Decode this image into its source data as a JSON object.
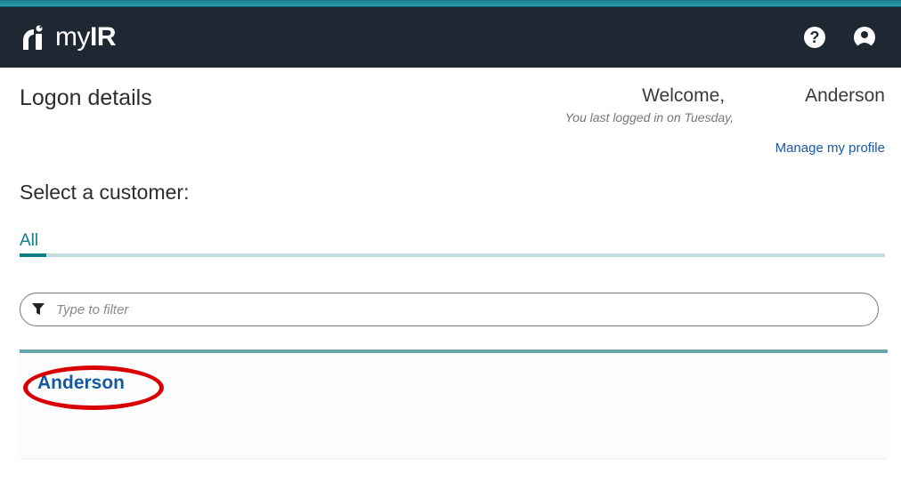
{
  "header": {
    "brand_my": "my",
    "brand_ir": "IR"
  },
  "page": {
    "title": "Logon details",
    "welcome_label": "Welcome,",
    "user_name": "Anderson",
    "last_login": "You last logged in on Tuesday,",
    "manage_profile": "Manage my profile",
    "section_title": "Select a customer:"
  },
  "tabs": {
    "all": "All"
  },
  "filter": {
    "placeholder": "Type to filter"
  },
  "customers": [
    {
      "name": "Anderson"
    }
  ]
}
